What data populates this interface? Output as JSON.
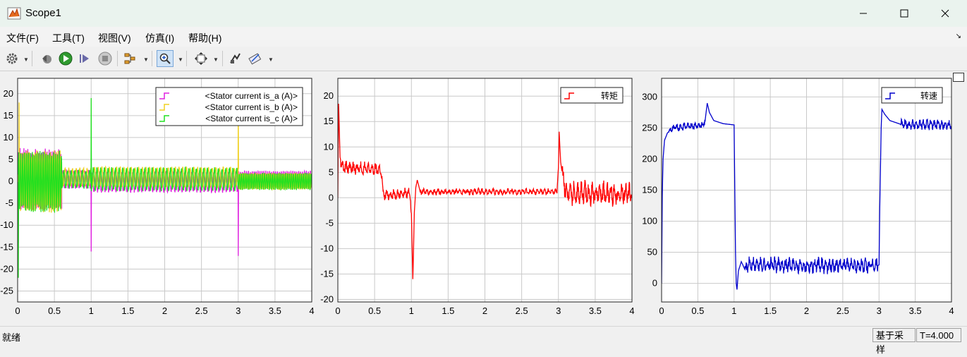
{
  "window": {
    "title": "Scope1",
    "controls": {
      "minimize_icon": "minimize-icon",
      "maximize_icon": "maximize-icon",
      "close_icon": "close-icon"
    }
  },
  "menu": {
    "items": [
      "文件(F)",
      "工具(T)",
      "视图(V)",
      "仿真(I)",
      "帮助(H)"
    ]
  },
  "toolbar": {
    "icons": [
      "gear-icon",
      "step-back-icon",
      "run-icon",
      "step-forward-icon",
      "stop-icon",
      "highlight-icon",
      "zoom-in-icon",
      "fit-icon",
      "style-icon",
      "cursor-measure-icon"
    ]
  },
  "status": {
    "ready": "就绪",
    "mode": "基于采样",
    "time": "T=4.000"
  },
  "colors": {
    "phase_a": "#e020e0",
    "phase_b": "#f0d020",
    "phase_c": "#20e020",
    "torque": "#ff0000",
    "speed": "#0000cc"
  },
  "chart_data": [
    {
      "type": "line",
      "xlim": [
        0,
        4
      ],
      "ylim": [
        -27.5,
        23.5
      ],
      "xticks": [
        "0",
        "0.5",
        "1",
        "1.5",
        "2",
        "2.5",
        "3",
        "3.5",
        "4"
      ],
      "yticks": [
        "-25",
        "-20",
        "-15",
        "-10",
        "-5",
        "0",
        "5",
        "10",
        "15",
        "20"
      ],
      "grid": true,
      "legend": "top-right",
      "series": [
        {
          "name": "<Stator current is_a (A)>",
          "color": "#e020e0",
          "segments": [
            {
              "x0": 0.0,
              "x1": 0.6,
              "amp": 6.5,
              "freq": 38,
              "phase": 0,
              "offset": 0.5
            },
            {
              "x0": 0.6,
              "x1": 1.0,
              "amp": 2.0,
              "freq": 20,
              "phase": 0,
              "offset": 0.5
            },
            {
              "x0": 1.0,
              "x1": 3.0,
              "amp": 2.2,
              "freq": 20,
              "phase": 0,
              "offset": -0.2
            },
            {
              "x0": 3.0,
              "x1": 4.0,
              "amp": 1.8,
              "freq": 38,
              "phase": 0,
              "offset": 0.5
            }
          ],
          "spikes": [
            {
              "x": 1.0,
              "y": -16
            },
            {
              "x": 3.0,
              "y": -17
            },
            {
              "x": 0.01,
              "y": -14
            }
          ]
        },
        {
          "name": "<Stator current is_b (A)>",
          "color": "#f0d020",
          "segments": [
            {
              "x0": 0.0,
              "x1": 0.6,
              "amp": 6.5,
              "freq": 38,
              "phase": 2.09,
              "offset": 0
            },
            {
              "x0": 0.6,
              "x1": 1.0,
              "amp": 2.0,
              "freq": 20,
              "phase": 2.09,
              "offset": 1
            },
            {
              "x0": 1.0,
              "x1": 3.0,
              "amp": 2.2,
              "freq": 20,
              "phase": 2.09,
              "offset": 1
            },
            {
              "x0": 3.0,
              "x1": 4.0,
              "amp": 1.8,
              "freq": 38,
              "phase": 2.09,
              "offset": 0
            }
          ],
          "spikes": [
            {
              "x": 0.02,
              "y": 18
            },
            {
              "x": 3.0,
              "y": 18
            }
          ]
        },
        {
          "name": "<Stator current is_c (A)>",
          "color": "#20e020",
          "segments": [
            {
              "x0": 0.0,
              "x1": 0.6,
              "amp": 6.5,
              "freq": 38,
              "phase": 4.19,
              "offset": 0
            },
            {
              "x0": 0.6,
              "x1": 1.0,
              "amp": 2.0,
              "freq": 20,
              "phase": 4.19,
              "offset": 0.5
            },
            {
              "x0": 1.0,
              "x1": 3.0,
              "amp": 2.5,
              "freq": 20,
              "phase": 4.19,
              "offset": 0.5
            },
            {
              "x0": 3.0,
              "x1": 4.0,
              "amp": 1.8,
              "freq": 38,
              "phase": 4.19,
              "offset": 0
            }
          ],
          "spikes": [
            {
              "x": 1.0,
              "y": 19
            },
            {
              "x": 0.01,
              "y": -22
            }
          ]
        }
      ]
    },
    {
      "type": "line",
      "xlim": [
        0,
        4
      ],
      "ylim": [
        -20.5,
        23.5
      ],
      "xticks": [
        "0",
        "0.5",
        "1",
        "1.5",
        "2",
        "2.5",
        "3",
        "3.5",
        "4"
      ],
      "yticks": [
        "-20",
        "-15",
        "-10",
        "-5",
        "0",
        "5",
        "10",
        "15",
        "20"
      ],
      "grid": true,
      "legend": "top-right",
      "series": [
        {
          "name": "转矩",
          "color": "#ff0000",
          "points": [
            [
              0,
              0
            ],
            [
              0.01,
              18.5
            ],
            [
              0.03,
              8
            ],
            [
              0.06,
              6
            ],
            [
              0.58,
              5.5
            ],
            [
              0.6,
              4
            ],
            [
              0.62,
              0.5
            ],
            [
              0.98,
              1
            ],
            [
              1.0,
              -3
            ],
            [
              1.02,
              -16
            ],
            [
              1.04,
              -3
            ],
            [
              1.06,
              2
            ],
            [
              1.08,
              3.5
            ],
            [
              1.12,
              1.2
            ],
            [
              2.98,
              1.2
            ],
            [
              3.0,
              6
            ],
            [
              3.01,
              13
            ],
            [
              3.03,
              7
            ],
            [
              3.07,
              3
            ],
            [
              3.12,
              1
            ],
            [
              4.0,
              0.8
            ]
          ],
          "noise": [
            {
              "x0": 0.04,
              "x1": 0.6,
              "amp": 1.2
            },
            {
              "x0": 0.62,
              "x1": 1.0,
              "amp": 1.0
            },
            {
              "x0": 1.12,
              "x1": 2.98,
              "amp": 0.6
            },
            {
              "x0": 3.05,
              "x1": 4.0,
              "amp": 2.2
            }
          ]
        }
      ]
    },
    {
      "type": "line",
      "xlim": [
        0,
        4
      ],
      "ylim": [
        -30,
        330
      ],
      "xticks": [
        "0",
        "0.5",
        "1",
        "1.5",
        "2",
        "2.5",
        "3",
        "3.5",
        "4"
      ],
      "yticks": [
        "0",
        "50",
        "100",
        "150",
        "200",
        "250",
        "300"
      ],
      "grid": true,
      "legend": "top-right",
      "series": [
        {
          "name": "转速",
          "color": "#0000cc",
          "points": [
            [
              0,
              0
            ],
            [
              0.01,
              140
            ],
            [
              0.02,
              200
            ],
            [
              0.04,
              230
            ],
            [
              0.08,
              242
            ],
            [
              0.15,
              250
            ],
            [
              0.3,
              252
            ],
            [
              0.55,
              254
            ],
            [
              0.6,
              262
            ],
            [
              0.63,
              290
            ],
            [
              0.66,
              275
            ],
            [
              0.72,
              262
            ],
            [
              0.85,
              257
            ],
            [
              1.0,
              255
            ],
            [
              1.01,
              150
            ],
            [
              1.02,
              50
            ],
            [
              1.03,
              0
            ],
            [
              1.04,
              -10
            ],
            [
              1.06,
              20
            ],
            [
              1.1,
              35
            ],
            [
              1.15,
              22
            ],
            [
              1.2,
              30
            ],
            [
              2.98,
              28
            ],
            [
              3.0,
              30
            ],
            [
              3.01,
              120
            ],
            [
              3.03,
              250
            ],
            [
              3.04,
              280
            ],
            [
              3.08,
              272
            ],
            [
              3.15,
              262
            ],
            [
              3.3,
              256
            ],
            [
              4.0,
              255
            ]
          ],
          "noise": [
            {
              "x0": 0.1,
              "x1": 0.6,
              "amp": 6
            },
            {
              "x0": 1.15,
              "x1": 2.98,
              "amp": 12
            },
            {
              "x0": 3.3,
              "x1": 4.0,
              "amp": 8
            }
          ]
        }
      ]
    }
  ]
}
